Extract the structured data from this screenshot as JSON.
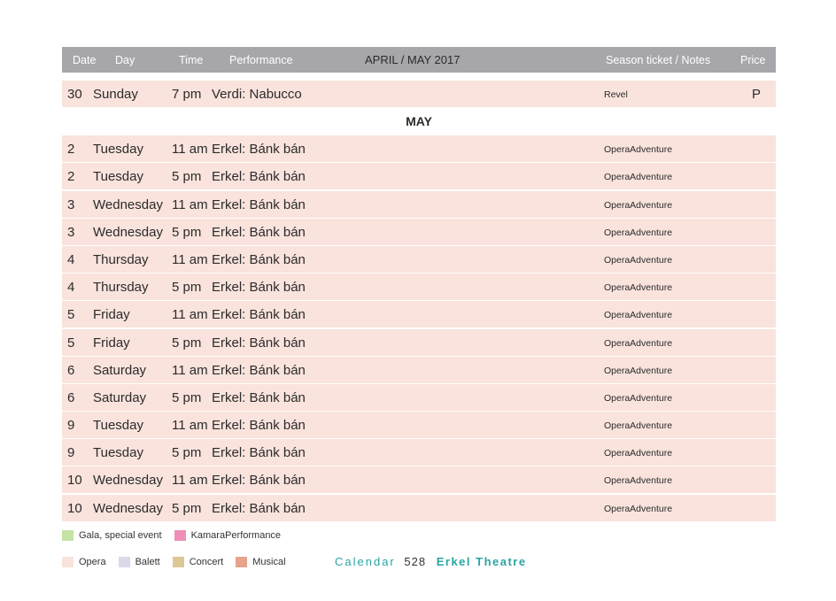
{
  "header": {
    "date": "Date",
    "day": "Day",
    "time": "Time",
    "performance": "Performance",
    "title": "APRIL / MAY 2017",
    "notes": "Season ticket / Notes",
    "price": "Price"
  },
  "april_row": {
    "date": "30",
    "day": "Sunday",
    "time": "7 pm",
    "performance": "Verdi: Nabucco",
    "notes": "Revel",
    "price": "P"
  },
  "month_label": "MAY",
  "rows": [
    {
      "date": "2",
      "day": "Tuesday",
      "time": "11 am",
      "performance": "Erkel: Bánk bán",
      "notes": "OperaAdventure"
    },
    {
      "date": "2",
      "day": "Tuesday",
      "time": "5 pm",
      "performance": "Erkel: Bánk bán",
      "notes": "OperaAdventure"
    },
    {
      "date": "3",
      "day": "Wednesday",
      "time": "11 am",
      "performance": "Erkel: Bánk bán",
      "notes": "OperaAdventure"
    },
    {
      "date": "3",
      "day": "Wednesday",
      "time": "5 pm",
      "performance": "Erkel: Bánk bán",
      "notes": "OperaAdventure"
    },
    {
      "date": "4",
      "day": "Thursday",
      "time": "11 am",
      "performance": "Erkel: Bánk bán",
      "notes": "OperaAdventure"
    },
    {
      "date": "4",
      "day": "Thursday",
      "time": "5 pm",
      "performance": "Erkel: Bánk bán",
      "notes": "OperaAdventure"
    },
    {
      "date": "5",
      "day": "Friday",
      "time": "11 am",
      "performance": "Erkel: Bánk bán",
      "notes": "OperaAdventure"
    },
    {
      "date": "5",
      "day": "Friday",
      "time": "5 pm",
      "performance": "Erkel: Bánk bán",
      "notes": "OperaAdventure"
    },
    {
      "date": "6",
      "day": "Saturday",
      "time": "11 am",
      "performance": "Erkel: Bánk bán",
      "notes": "OperaAdventure"
    },
    {
      "date": "6",
      "day": "Saturday",
      "time": "5 pm",
      "performance": "Erkel: Bánk bán",
      "notes": "OperaAdventure"
    },
    {
      "date": "9",
      "day": "Tuesday",
      "time": "11 am",
      "performance": "Erkel: Bánk bán",
      "notes": "OperaAdventure"
    },
    {
      "date": "9",
      "day": "Tuesday",
      "time": "5 pm",
      "performance": "Erkel: Bánk bán",
      "notes": "OperaAdventure"
    },
    {
      "date": "10",
      "day": "Wednesday",
      "time": "11 am",
      "performance": "Erkel: Bánk bán",
      "notes": "OperaAdventure"
    },
    {
      "date": "10",
      "day": "Wednesday",
      "time": "5 pm",
      "performance": "Erkel: Bánk bán",
      "notes": "OperaAdventure"
    }
  ],
  "legend": {
    "row1": [
      {
        "label": "Gala, special event",
        "color": "#c5e3a4"
      },
      {
        "label": "KamaraPerformance",
        "color": "#ef8fb8"
      }
    ],
    "row2": [
      {
        "label": "Opera",
        "color": "#f9e3dc"
      },
      {
        "label": "Balett",
        "color": "#dcd8ec"
      },
      {
        "label": "Concert",
        "color": "#dcc894"
      },
      {
        "label": "Musical",
        "color": "#e6a48c"
      }
    ]
  },
  "footer": {
    "calendar": "Calendar",
    "page": "528",
    "theatre": "Erkel Theatre"
  },
  "colors": {
    "header_bg": "#a7a7ab",
    "row_bg": "#f9e3dc",
    "accent": "#2aa5a5"
  }
}
